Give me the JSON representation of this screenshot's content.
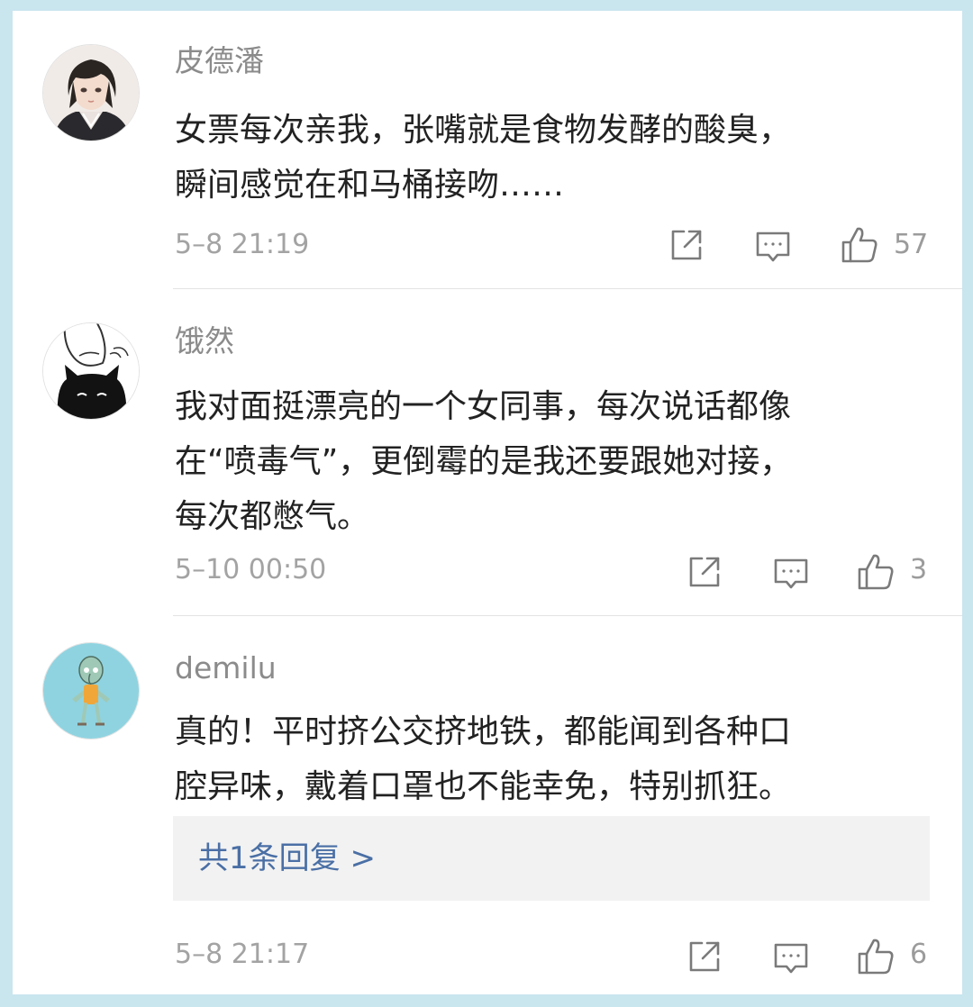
{
  "comments": [
    {
      "avatar_icon": "anime-girl-avatar",
      "username": "皮德潘",
      "content_lines": [
        "女票每次亲我，张嘴就是食物发酵的酸臭，",
        "瞬间感觉在和马桶接吻……"
      ],
      "time": "5–8 21:19",
      "share_icon": "share-icon",
      "comment_icon": "comment-icon",
      "like_icon": "thumbs-up-icon",
      "likes": "57"
    },
    {
      "avatar_icon": "black-cat-avatar",
      "username": "饿然",
      "content_lines": [
        "我对面挺漂亮的一个女同事，每次说话都像",
        "在“喷毒气”，更倒霉的是我还要跟她对接，",
        "每次都憋气。"
      ],
      "time": "5–10 00:50",
      "share_icon": "share-icon",
      "comment_icon": "comment-icon",
      "like_icon": "thumbs-up-icon",
      "likes": "3"
    },
    {
      "avatar_icon": "squidward-avatar",
      "username": "demilu",
      "content_lines": [
        "真的！平时挤公交挤地铁，都能闻到各种口",
        "腔异味，戴着口罩也不能幸免，特别抓狂。"
      ],
      "reply_link": "共1条回复 >",
      "time": "5–8 21:17",
      "share_icon": "share-icon",
      "comment_icon": "comment-icon",
      "like_icon": "thumbs-up-icon",
      "likes": "6"
    }
  ],
  "colors": {
    "background": "#c9e5ee",
    "card": "#ffffff",
    "username": "#8b8b8b",
    "content": "#222222",
    "meta": "#a3a3a3",
    "reply_link": "#4a6fa5",
    "reply_bg": "#f2f2f2"
  }
}
